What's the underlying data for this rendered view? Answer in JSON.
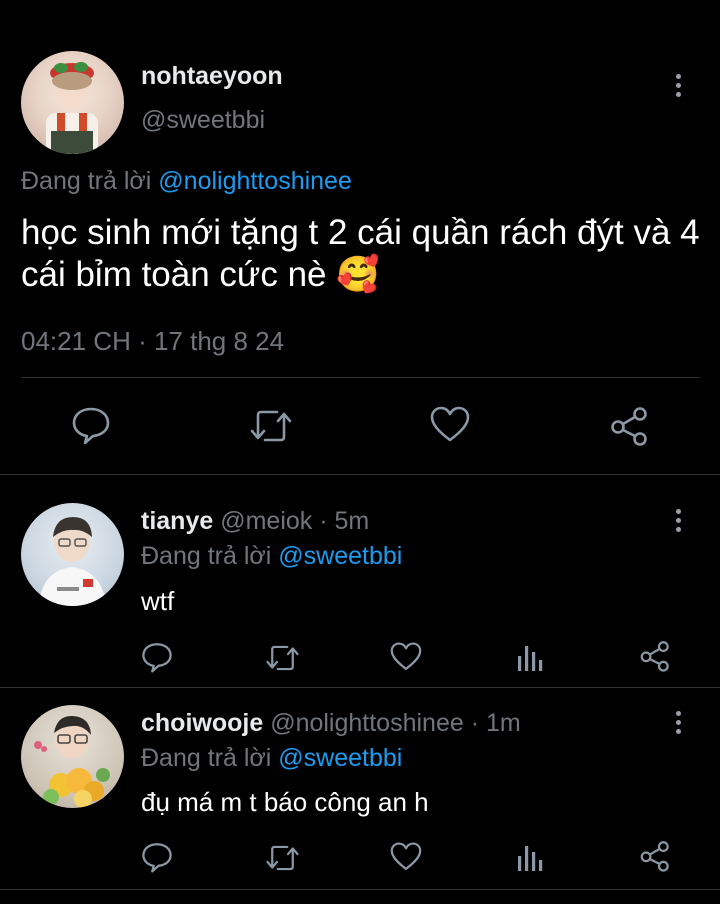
{
  "main_tweet": {
    "display_name": "nohtaeyoon",
    "handle": "@sweetbbi",
    "replying_prefix": "Đang trả lời",
    "replying_to": "@nolighttoshinee",
    "text": "học sinh mới tặng t 2 cái quần rách đýt và 4 cái bỉm toàn cức nè",
    "emoji": "🥰",
    "timestamp": "04:21 CH · 17 thg 8 24"
  },
  "replies": [
    {
      "display_name": "tianye",
      "handle": "@meiok",
      "time": "· 5m",
      "replying_prefix": "Đang trả lời",
      "replying_to": "@sweetbbi",
      "text": "wtf"
    },
    {
      "display_name": "choiwooje",
      "handle": "@nolighttoshinee",
      "time": "· 1m",
      "replying_prefix": "Đang trả lời",
      "replying_to": "@sweetbbi",
      "text": "đụ má m t báo công an h"
    }
  ],
  "icons": {
    "reply": "speech-bubble-icon",
    "retweet": "retweet-icon",
    "like": "heart-icon",
    "share": "share-icon",
    "analytics": "bar-chart-icon",
    "more": "vertical-dots-icon"
  },
  "colors": {
    "background": "#000000",
    "text": "#e7e9ea",
    "secondary": "#71767b",
    "link": "#1d9bf0",
    "divider": "#2f3336"
  }
}
